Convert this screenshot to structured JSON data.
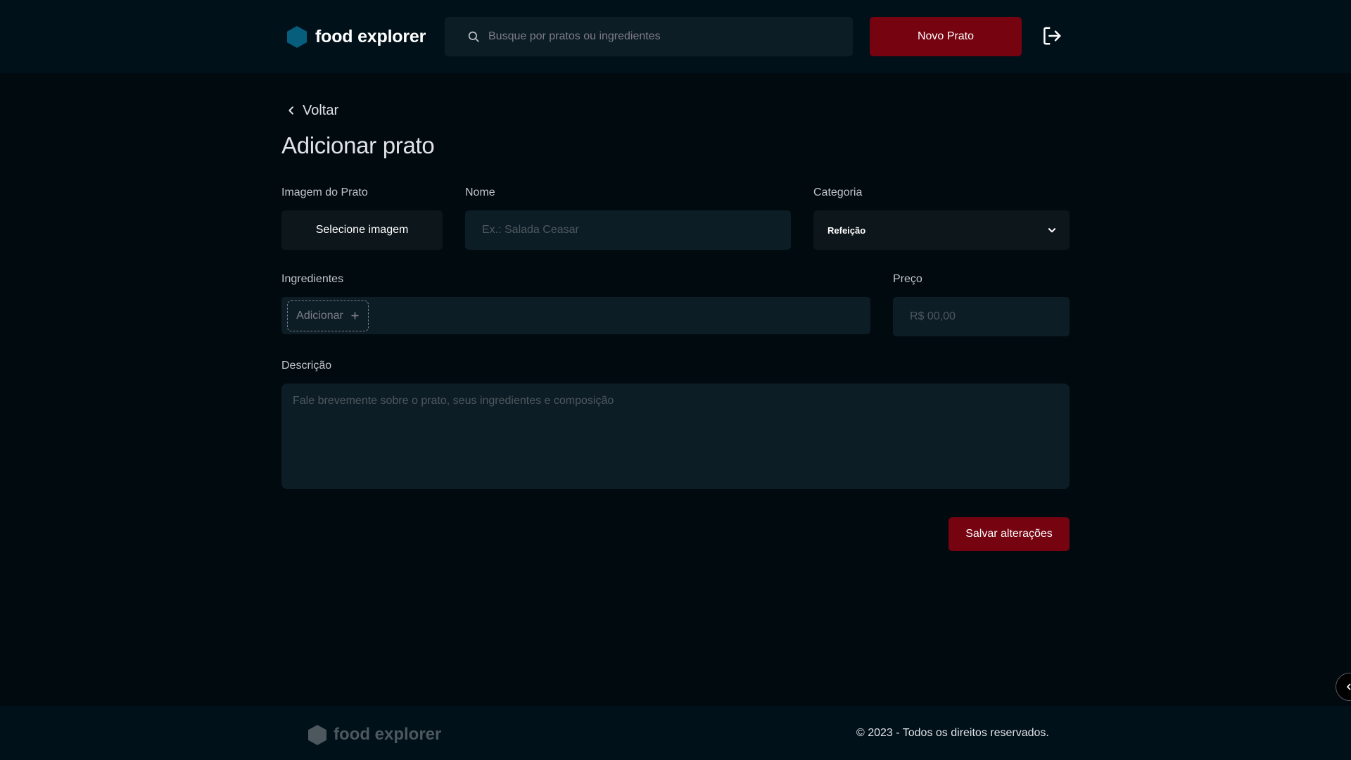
{
  "header": {
    "brand": "food explorer",
    "search_placeholder": "Busque por pratos ou ingredientes",
    "new_dish_label": "Novo Prato",
    "logout_icon": "sign-out-icon"
  },
  "nav": {
    "back_label": "Voltar"
  },
  "page": {
    "title": "Adicionar prato"
  },
  "form": {
    "image_label": "Imagem do Prato",
    "image_button": "Selecione imagem",
    "name_label": "Nome",
    "name_placeholder": "Ex.: Salada Ceasar",
    "category_label": "Categoria",
    "category_value": "Refeição",
    "ingredients_label": "Ingredientes",
    "ingredient_add_placeholder": "Adicionar",
    "price_label": "Preço",
    "price_placeholder": "R$ 00,00",
    "description_label": "Descrição",
    "description_placeholder": "Fale brevemente sobre o prato, seus ingredientes e composição",
    "save_label": "Salvar alterações"
  },
  "footer": {
    "brand": "food explorer",
    "copyright": "© 2023 - Todos os direitos reservados."
  },
  "colors": {
    "background": "#000a0f",
    "header": "#00111a",
    "accent": "#750310",
    "logo": "#065e7c",
    "input": "#0d1d25"
  }
}
